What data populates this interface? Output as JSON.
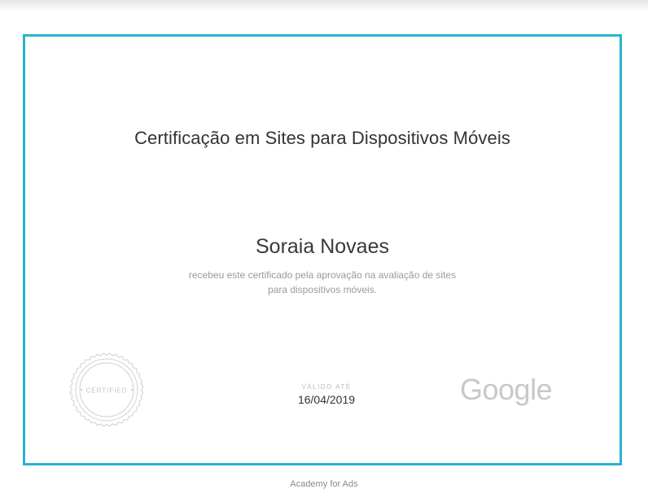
{
  "certificate": {
    "title": "Certificação em Sites para Dispositivos Móveis",
    "recipient": "Soraia Novaes",
    "description_line1": "recebeu este certificado pela aprovação na avaliação de sites",
    "description_line2": "para dispositivos móveis.",
    "seal_text": "CERTIFIED",
    "validity_label": "VÁLIDO ATÉ",
    "validity_date": "16/04/2019",
    "issuer_logo": "Google",
    "border_color": "#26b4cf"
  },
  "footer": {
    "text": "Academy for Ads"
  }
}
